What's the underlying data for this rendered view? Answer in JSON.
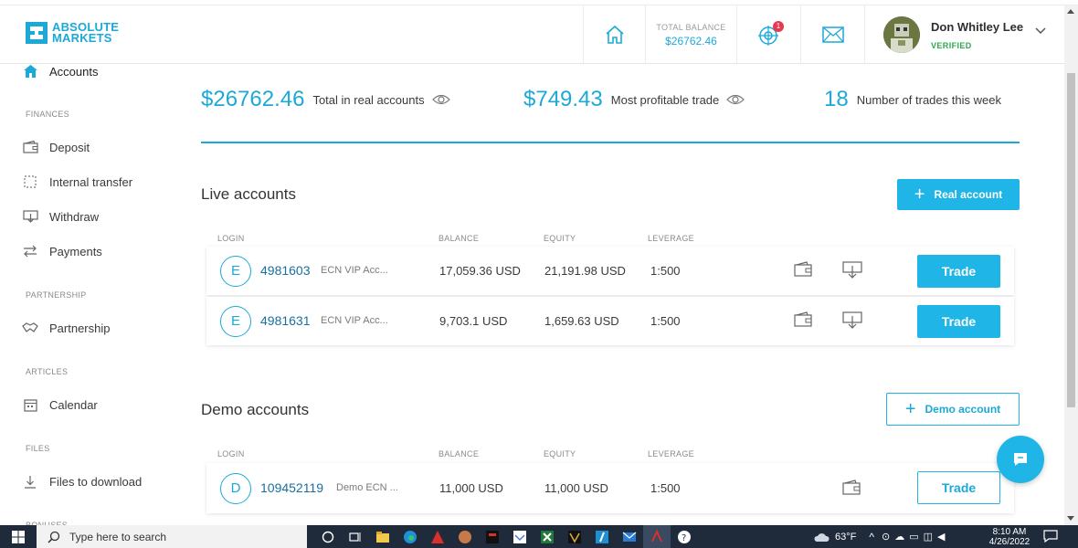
{
  "brand": {
    "line1": "ABSOLUTE",
    "line2": "MARKETS",
    "color": "#1ca9d8"
  },
  "header": {
    "balance_label": "TOTAL BALANCE",
    "balance_value": "$26762.46",
    "notifications_count": "1",
    "user_name": "Don Whitley Lee",
    "user_status": "VERIFIED"
  },
  "sidebar": {
    "accounts": "Accounts",
    "section_finances": "FINANCES",
    "deposit": "Deposit",
    "internal_transfer": "Internal transfer",
    "withdraw": "Withdraw",
    "payments": "Payments",
    "section_partnership": "PARTNERSHIP",
    "partnership": "Partnership",
    "section_articles": "ARTICLES",
    "calendar": "Calendar",
    "section_files": "FILES",
    "files_to_download": "Files to download",
    "section_bonuses": "BONUSES"
  },
  "stats": {
    "total_value": "$26762.46",
    "total_label": "Total in real accounts",
    "profit_value": "$749.43",
    "profit_label": "Most profitable trade",
    "trades_value": "18",
    "trades_label": "Number of trades this week"
  },
  "live": {
    "title": "Live accounts",
    "add_button": "Real account",
    "columns": {
      "login": "LOGIN",
      "balance": "BALANCE",
      "equity": "EQUITY",
      "leverage": "LEVERAGE"
    },
    "rows": [
      {
        "letter": "E",
        "login": "4981603",
        "type": "ECN VIP Acc...",
        "balance": "17,059.36 USD",
        "equity": "21,191.98 USD",
        "leverage": "1:500",
        "action": "Trade"
      },
      {
        "letter": "E",
        "login": "4981631",
        "type": "ECN VIP Acc...",
        "balance": "9,703.1 USD",
        "equity": "1,659.63 USD",
        "leverage": "1:500",
        "action": "Trade"
      }
    ]
  },
  "demo": {
    "title": "Demo accounts",
    "add_button": "Demo account",
    "columns": {
      "login": "LOGIN",
      "balance": "BALANCE",
      "equity": "EQUITY",
      "leverage": "LEVERAGE"
    },
    "rows": [
      {
        "letter": "D",
        "login": "109452119",
        "type": "Demo ECN ...",
        "balance": "11,000 USD",
        "equity": "11,000 USD",
        "leverage": "1:500",
        "action": "Trade"
      }
    ]
  },
  "taskbar": {
    "search_placeholder": "Type here to search",
    "weather": "63°F",
    "time": "8:10 AM",
    "date": "4/26/2022"
  },
  "icons": [
    "home-icon",
    "target-icon",
    "mail-icon",
    "eye-icon",
    "wallet-icon",
    "download-icon",
    "chat-icon"
  ]
}
